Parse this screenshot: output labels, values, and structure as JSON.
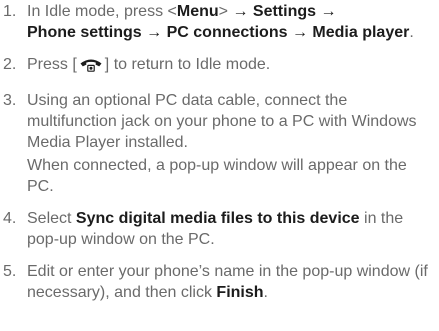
{
  "steps": [
    {
      "number": "1.",
      "parts": {
        "a": "In Idle mode, press <",
        "menu": "Menu",
        "b": "> ",
        "arrow1": "→",
        "settings": "Settings",
        "arrow2": "→",
        "phone_settings": "Phone settings",
        "arrow3": "→",
        "pc_connections": "PC connections",
        "arrow4": "→",
        "media_player": "Media player",
        "end": "."
      }
    },
    {
      "number": "2.",
      "parts": {
        "a": "Press [",
        "key_icon": "end-call-key-icon",
        "b": "] to return to Idle mode."
      }
    },
    {
      "number": "3.",
      "text": "Using an optional PC data cable, connect the multifunction jack on your phone to a PC with Windows Media Player installed.",
      "note": "When connected, a pop-up window will appear on the PC."
    },
    {
      "number": "4.",
      "parts": {
        "a": "Select ",
        "sync": "Sync digital media files to this device",
        "b": " in the pop-up window on the PC."
      }
    },
    {
      "number": "5.",
      "parts": {
        "a": "Edit or enter your phone’s name in the pop-up window (if necessary), and then click ",
        "finish": "Finish",
        "end": "."
      }
    }
  ],
  "colors": {
    "body_text": "#6a6a6a",
    "emphasis_text": "#1c1c1c",
    "background": "#ffffff"
  }
}
